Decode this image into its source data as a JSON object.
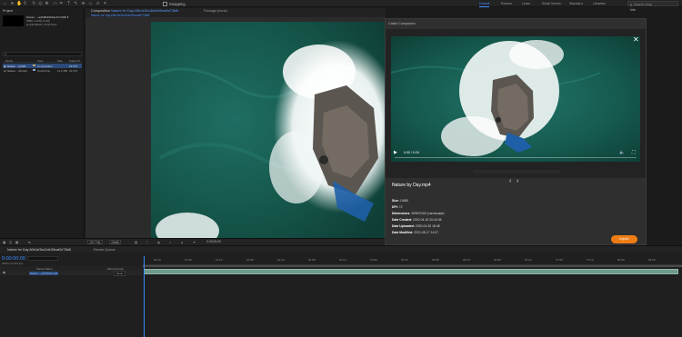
{
  "toolbar": {
    "snapping_label": "Snapping",
    "workspaces": [
      "Default",
      "Review",
      "Learn",
      "Small Screen",
      "Standard",
      "Libraries"
    ],
    "active_workspace": "Default",
    "search_placeholder": "Search Help"
  },
  "project": {
    "tab_label": "Project",
    "selected_name": "Nature ...o(2MBnMb6ax0xT3b8l ▾",
    "meta": [
      "3896 x 2160 (1.00)",
      "Δ 0;00;08;20, 23.976 fps"
    ],
    "columns": [
      "Name",
      "Type",
      "Size",
      "Frame R"
    ],
    "items": [
      {
        "name": "Nature ...iyCWl...",
        "type": "Composition",
        "size": "",
        "frame_rate": "23.976"
      },
      {
        "name": "Nature ...ichxsjd",
        "type": "QuickTime",
        "size": "14.2 MB",
        "frame_rate": "23.976"
      }
    ]
  },
  "composition": {
    "tab_prefix": "Composition",
    "tab_name": "Nature for Day-iWbJsGbuDdeG6nal9xT3b8l",
    "footage_tab": "Footage (none)",
    "subtab": "Nature for Day-iWbJsGbuDdeG6nal9xT3b8l"
  },
  "viewer_controls": {
    "zoom": "(37.7%)",
    "resolution": "(Half)",
    "timecode": "0;00;00;00"
  },
  "panel_right": {
    "info_tab": "Info"
  },
  "modal": {
    "title": "Castle Companion",
    "video_time": "0:00 / 0:24",
    "file_title": "Nature by Day.mp4",
    "details": [
      {
        "label": "Size:",
        "value": "14MB"
      },
      {
        "label": "DPI:",
        "value": "72"
      },
      {
        "label": "Dimensions:",
        "value": "4096*2160 (Landscape)"
      },
      {
        "label": "Date Created:",
        "value": "2020-04-30 20:44:36"
      },
      {
        "label": "Date Uploaded:",
        "value": "2020-04-30 18:48"
      },
      {
        "label": "Date Modified:",
        "value": "2021-05-17 14:37"
      }
    ],
    "import_label": "Import"
  },
  "timeline": {
    "tab_label": "Nature for Day-iWbJsGbuDdeG6nal9xT3b8l",
    "render_queue_label": "Render Queue",
    "timecode": "0:00:00:00",
    "frames": "00000 (23.976 fps)",
    "column_headers": [
      "Source Name",
      "Parent & Link"
    ],
    "layer_name": "Nature ...jof7Jhifd.mp4",
    "layer_parent": "None",
    "ticks": [
      "00:12f",
      "01:00f",
      "01:12f",
      "02:00f",
      "02:12f",
      "03:00f",
      "03:12f",
      "04:00f",
      "04:12f",
      "05:00f",
      "05:12f",
      "06:00f",
      "06:12f",
      "07:00f",
      "07:12f",
      "08:00f",
      "08:12f"
    ]
  }
}
